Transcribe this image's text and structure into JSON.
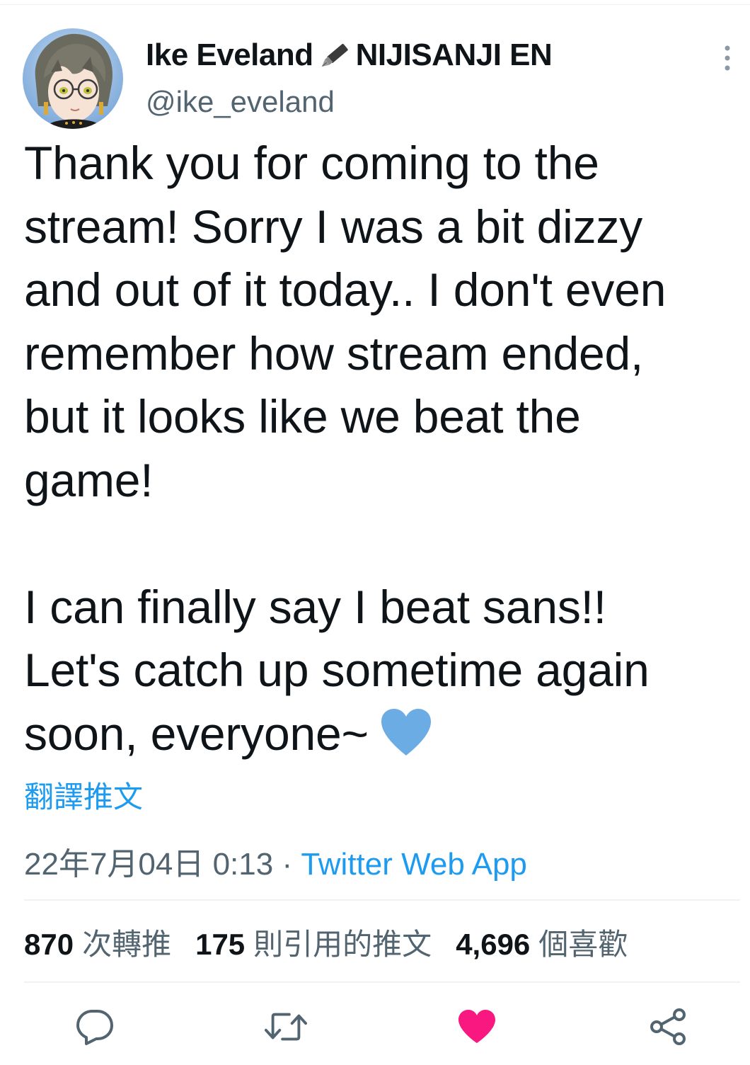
{
  "author": {
    "display_name_part1": "Ike Eveland",
    "display_name_part2": "NIJISANJI EN",
    "name_emoji_icon": "fountain-pen-icon",
    "handle": "@ike_eveland"
  },
  "menu": {
    "icon": "more-vertical-icon"
  },
  "tweet": {
    "text": "Thank you for coming to the\nstream! Sorry I was a bit dizzy\nand out of it today.. I don't even\nremember how stream ended,\nbut it looks like we beat the\ngame!\n\nI can finally say I beat sans!!\nLet's catch up sometime again\nsoon, everyone~",
    "trailing_emoji_icon": "blue-heart-icon",
    "translate_label": "翻譯推文",
    "timestamp": "22年7月04日 0:13 · ",
    "source": "Twitter Web App"
  },
  "stats": {
    "retweets_count": "870",
    "retweets_label": "次轉推",
    "quotes_count": "175",
    "quotes_label": "則引用的推文",
    "likes_count": "4,696",
    "likes_label": "個喜歡"
  },
  "actions": {
    "reply_icon": "reply-icon",
    "retweet_icon": "retweet-icon",
    "like_icon": "heart-icon",
    "share_icon": "share-icon"
  },
  "colors": {
    "accent": "#1d9bf0",
    "like": "#f91880",
    "muted": "#536471",
    "text": "#0f1419",
    "blue_heart": "#6cace4"
  }
}
